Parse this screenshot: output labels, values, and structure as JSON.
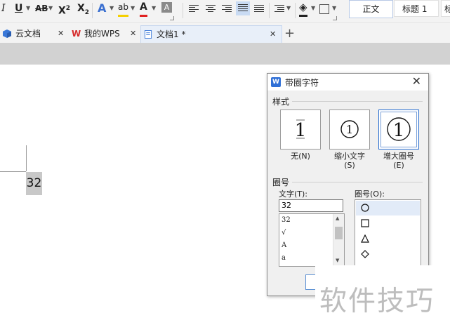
{
  "ribbon": {
    "italic": "I",
    "underline": "U",
    "strike": "AB",
    "superscript": "X",
    "sup_mark": "2",
    "subscript": "X",
    "sub_mark": "2",
    "text_effect": "A",
    "highlight": "ab",
    "font_color": "A",
    "char_shading": "A",
    "styles": [
      "正文",
      "标题 1",
      "标"
    ],
    "accent_highlight": "#f5d000",
    "accent_fontcolor": "#e02020"
  },
  "tabs": [
    {
      "label": "云文档",
      "icon": "cube-icon"
    },
    {
      "label": "我的WPS",
      "icon": "wps-logo-icon"
    },
    {
      "label": "文档1 *",
      "icon": "document-icon"
    }
  ],
  "tab_close": "✕",
  "new_tab": "+",
  "document": {
    "text": "32"
  },
  "dialog": {
    "title": "带圈字符",
    "close": "✕",
    "style_group": "样式",
    "styles": [
      {
        "label": "无",
        "hotkey": "(N)"
      },
      {
        "label": "缩小文字",
        "hotkey": "(S)"
      },
      {
        "label": "增大圈号",
        "hotkey": "(E)"
      }
    ],
    "selected_style": "增大圈号",
    "enclosure_group": "圈号",
    "text_label": "文字(T):",
    "text_value": "32",
    "text_list": [
      "32",
      "√",
      "A",
      "a"
    ],
    "enclosure_label": "圈号(O):",
    "enclosures": [
      "circle",
      "square",
      "triangle",
      "diamond"
    ],
    "selected_enclosure": "circle"
  },
  "watermark": "软件技巧"
}
